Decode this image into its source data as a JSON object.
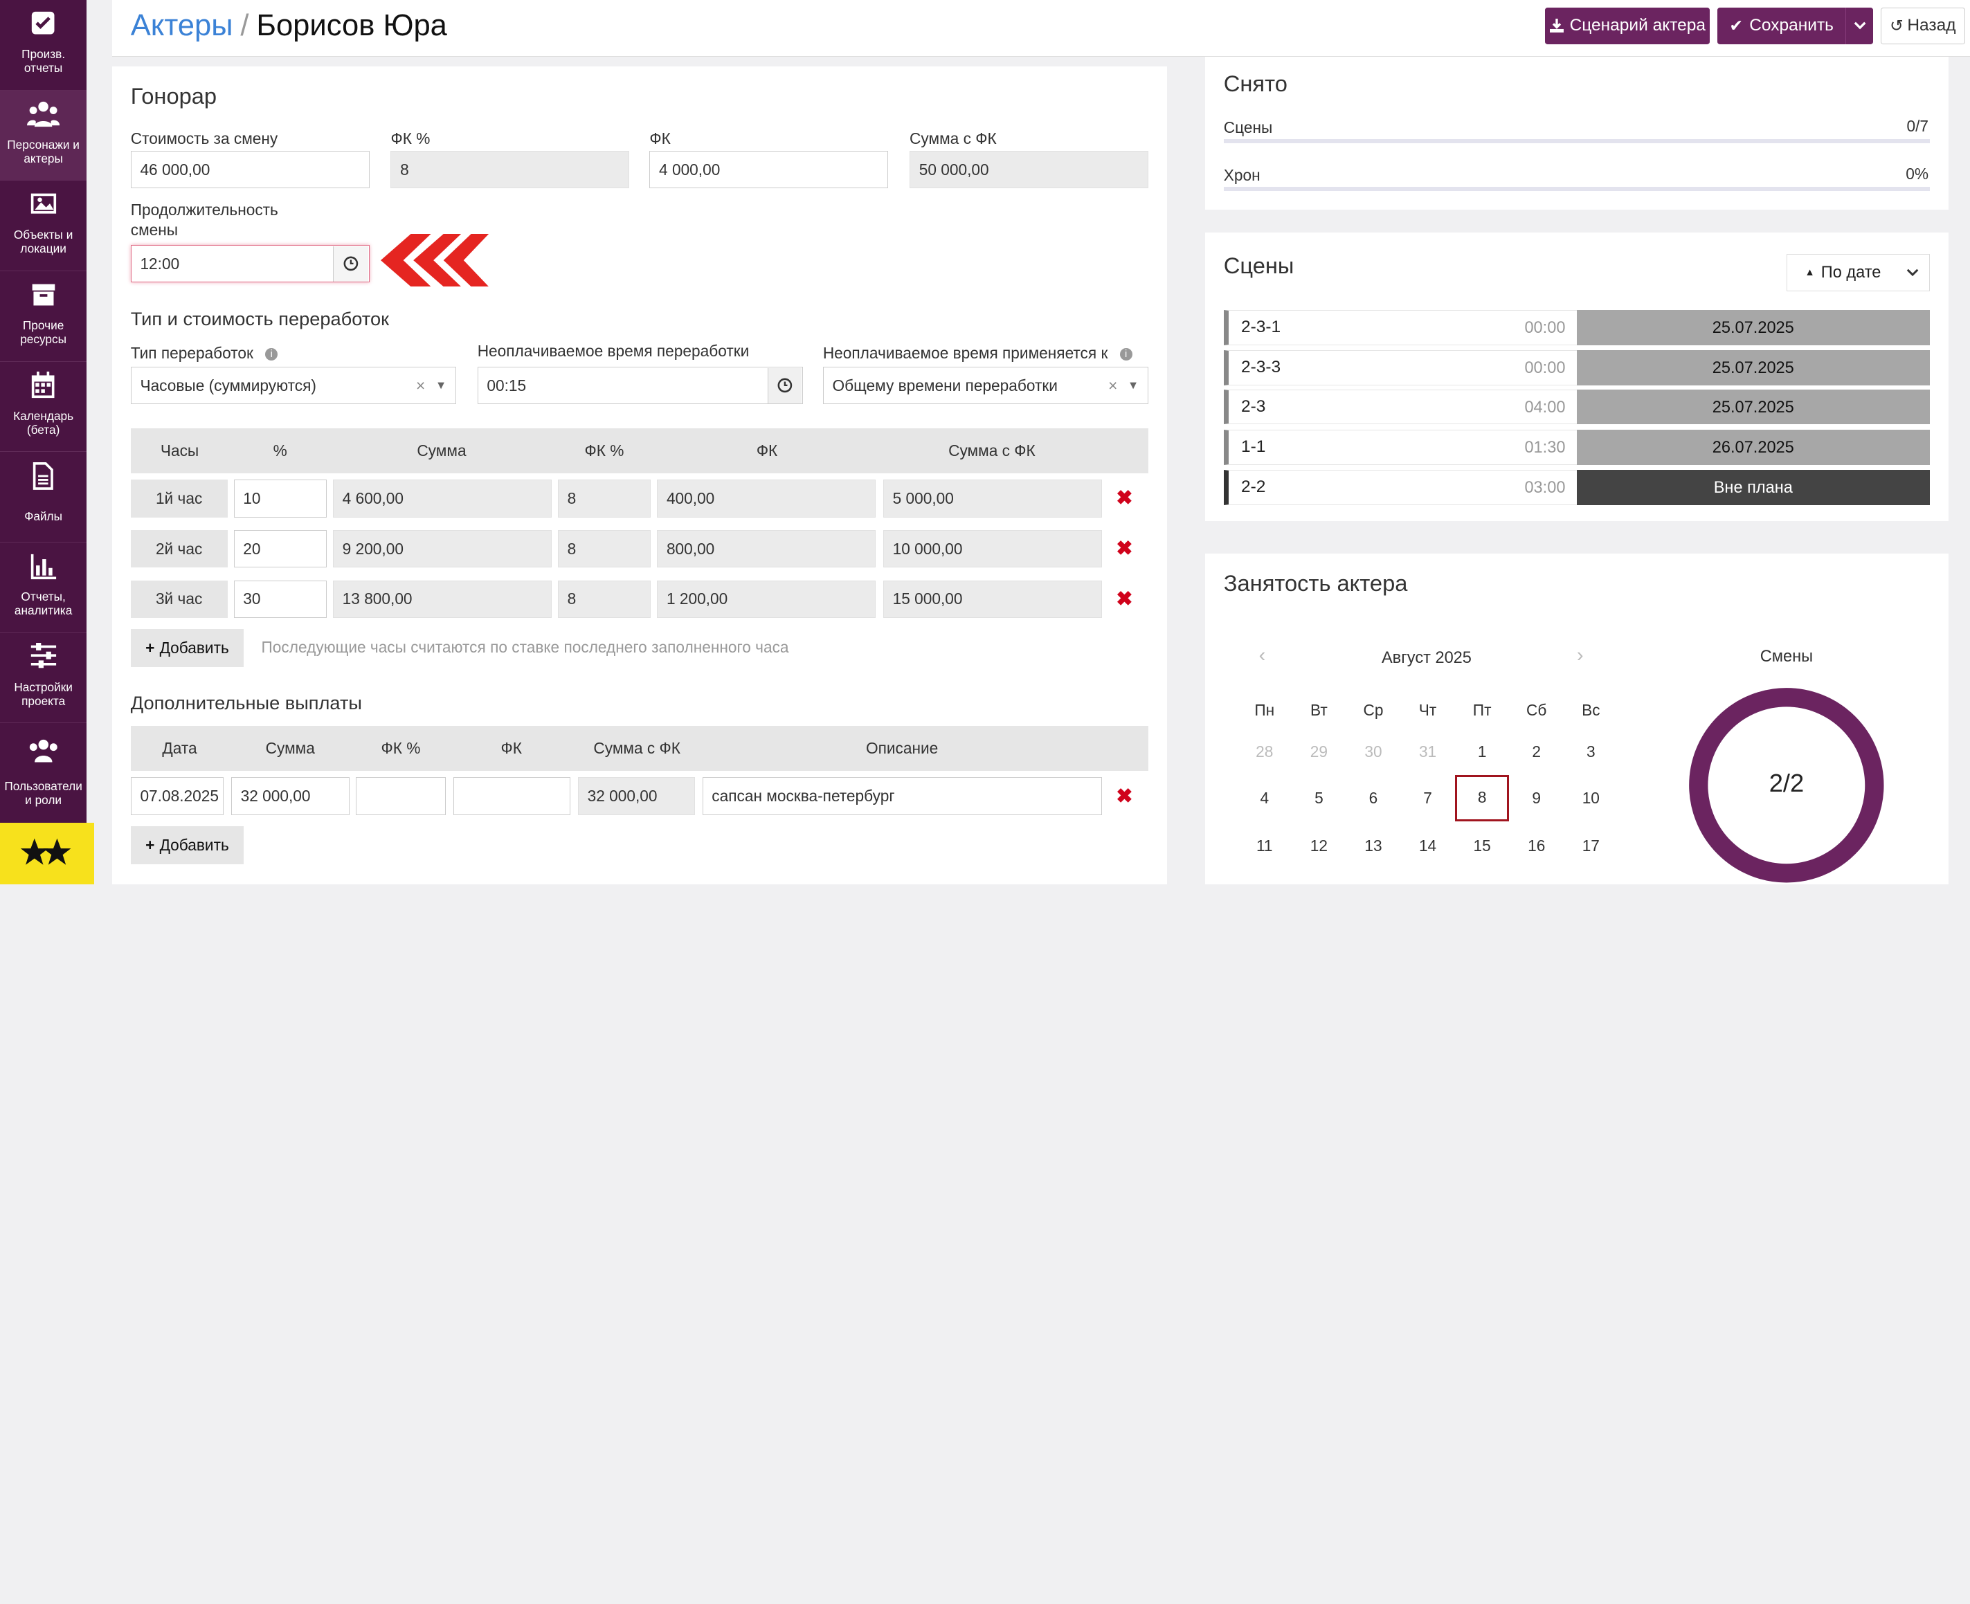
{
  "sidebar": {
    "items": [
      {
        "label": "Произв. отчеты",
        "icon": "checkbox-icon"
      },
      {
        "label": "Персонажи и актеры",
        "icon": "users-icon"
      },
      {
        "label": "Объекты и локации",
        "icon": "image-icon"
      },
      {
        "label": "Прочие ресурсы",
        "icon": "archive-icon"
      },
      {
        "label": "Календарь (бета)",
        "icon": "calendar-icon"
      },
      {
        "label": "Файлы",
        "icon": "file-icon"
      },
      {
        "label": "Отчеты, аналитика",
        "icon": "bar-chart-icon"
      },
      {
        "label": "Настройки проекта",
        "icon": "sliders-icon"
      },
      {
        "label": "Пользователи и роли",
        "icon": "user-group-icon"
      }
    ]
  },
  "header": {
    "crumb_link": "Актеры",
    "crumb_sep": "/",
    "title": "Борисов Юра",
    "btn_script": "Сценарий актера",
    "btn_save": "Сохранить",
    "btn_back": "Назад"
  },
  "fee": {
    "title": "Гонорар",
    "shift_cost_label": "Стоимость за смену",
    "shift_cost": "46 000,00",
    "fk_pct_label": "ФК %",
    "fk_pct": "8",
    "fk_label": "ФК",
    "fk": "4 000,00",
    "sum_fk_label": "Сумма с ФК",
    "sum_fk": "50 000,00",
    "duration_label_1": "Продолжительность",
    "duration_label_2": "смены",
    "duration": "12:00"
  },
  "overtime": {
    "title": "Тип и стоимость переработок",
    "type_label": "Тип переработок",
    "type_value": "Часовые (суммируются)",
    "unpaid_label": "Неоплачиваемое время переработки",
    "unpaid_value": "00:15",
    "applies_label": "Неоплачиваемое время применяется к",
    "applies_value": "Общему времени переработки",
    "columns": [
      "Часы",
      "%",
      "Сумма",
      "ФК %",
      "ФК",
      "Сумма с ФК"
    ],
    "rows": [
      {
        "hour": "1й час",
        "pct": "10",
        "sum": "4 600,00",
        "fkpct": "8",
        "fk": "400,00",
        "sumfk": "5 000,00"
      },
      {
        "hour": "2й час",
        "pct": "20",
        "sum": "9 200,00",
        "fkpct": "8",
        "fk": "800,00",
        "sumfk": "10 000,00"
      },
      {
        "hour": "3й час",
        "pct": "30",
        "sum": "13 800,00",
        "fkpct": "8",
        "fk": "1 200,00",
        "sumfk": "15 000,00"
      }
    ],
    "add_label": "Добавить",
    "hint": "Последующие часы считаются по ставке последнего заполненного часа"
  },
  "extra": {
    "title": "Дополнительные выплаты",
    "columns": [
      "Дата",
      "Сумма",
      "ФК %",
      "ФК",
      "Сумма с ФК",
      "Описание"
    ],
    "rows": [
      {
        "date": "07.08.2025",
        "sum": "32 000,00",
        "fkpct": "",
        "fk": "",
        "sumfk": "32 000,00",
        "desc": "сапсан москва-петербург"
      }
    ],
    "add_label": "Добавить"
  },
  "shot": {
    "title": "Снято",
    "scenes_label": "Сцены",
    "scenes_value": "0/7",
    "chron_label": "Хрон",
    "chron_value": "0%",
    "scenes_progress": 0,
    "chron_progress": 0
  },
  "scenes": {
    "title": "Сцены",
    "sort_label": "По дате",
    "items": [
      {
        "name": "2-3-1",
        "time": "00:00",
        "date": "25.07.2025"
      },
      {
        "name": "2-3-3",
        "time": "00:00",
        "date": "25.07.2025"
      },
      {
        "name": "2-3",
        "time": "04:00",
        "date": "25.07.2025"
      },
      {
        "name": "1-1",
        "time": "01:30",
        "date": "26.07.2025"
      },
      {
        "name": "2-2",
        "time": "03:00",
        "date": "Вне плана"
      }
    ]
  },
  "busy": {
    "title": "Занятость актера",
    "month": "Август 2025",
    "weekdays": [
      "Пн",
      "Вт",
      "Ср",
      "Чт",
      "Пт",
      "Сб",
      "Вс"
    ],
    "weeks": [
      [
        "28",
        "29",
        "30",
        "31",
        "1",
        "2",
        "3"
      ],
      [
        "4",
        "5",
        "6",
        "7",
        "8",
        "9",
        "10"
      ],
      [
        "11",
        "12",
        "13",
        "14",
        "15",
        "16",
        "17"
      ]
    ],
    "selected": "8",
    "shifts_label": "Смены",
    "shifts_value": "2/2",
    "shifts_fraction": 1
  },
  "colors": {
    "brand": "#6b2460",
    "sidebar": "#4a1442",
    "accent_red": "#e52521",
    "delete": "#d0021b",
    "link": "#3b82d6"
  }
}
